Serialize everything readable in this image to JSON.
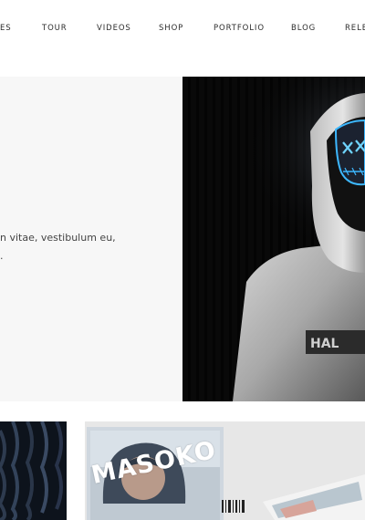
{
  "nav": {
    "items": [
      {
        "label": "ES"
      },
      {
        "label": "TOUR"
      },
      {
        "label": "VIDEOS"
      },
      {
        "label": "SHOP"
      },
      {
        "label": "PORTFOLIO"
      },
      {
        "label": "BLOG"
      },
      {
        "label": "RELE"
      }
    ]
  },
  "intro": {
    "line1": "n vitae, vestibulum eu,",
    "line2": "."
  },
  "album": {
    "title": "MASOKO"
  },
  "icons": {
    "hero": "masked-hooded-figure",
    "left_thumb": "dark-wave-texture",
    "right_thumb": "album-cd-mockup"
  }
}
